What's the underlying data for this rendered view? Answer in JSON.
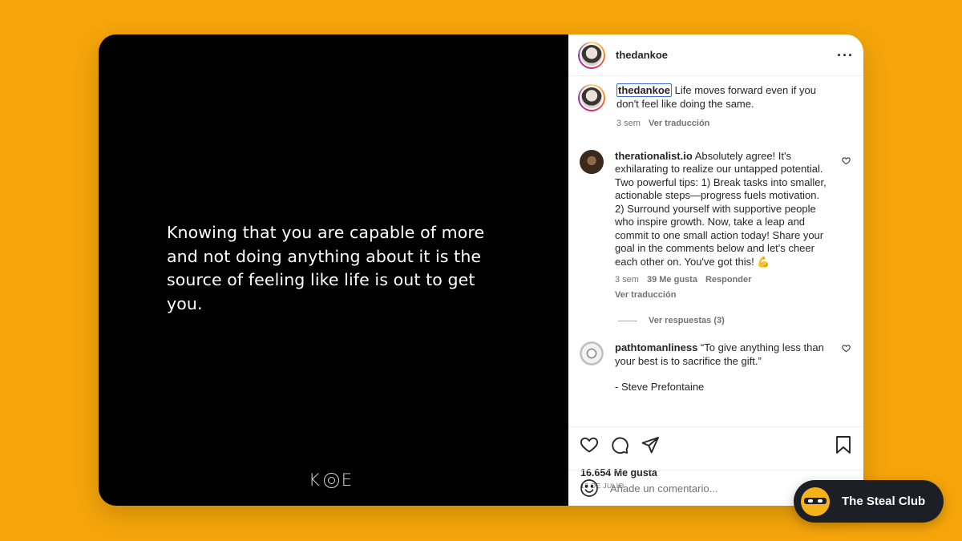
{
  "post": {
    "quote": "Knowing that you are capable of more and not doing anything about it is the source of feeling like life is out to get you.",
    "logo_text": "KOE"
  },
  "header": {
    "username": "thedankoe",
    "more_icon": "more-horizontal-icon"
  },
  "caption": {
    "username": "thedankoe",
    "text": "Life moves forward even if you don't feel like doing the same.",
    "time": "3 sem",
    "translate_label": "Ver traducción"
  },
  "comments": [
    {
      "username": "therationalist.io",
      "text": "Absolutely agree! It's exhilarating to realize our untapped potential. Two powerful tips: 1) Break tasks into smaller, actionable steps—progress fuels motivation. 2) Surround yourself with supportive people who inspire growth. Now, take a leap and commit to one small action today! Share your goal in the comments below and let's cheer each other on. You've got this! 💪",
      "time": "3 sem",
      "likes": "39 Me gusta",
      "reply_label": "Responder",
      "translate_label": "Ver traducción",
      "view_replies": "Ver respuestas (3)"
    },
    {
      "username": "pathtomanliness",
      "text": "“To give anything less than your best is to sacrifice the gift.”",
      "extra": "- Steve Prefontaine"
    }
  ],
  "actions": {
    "likes_count": "16.654 Me gusta",
    "date": "18 DE JULIO"
  },
  "add_comment": {
    "placeholder": "Añade un comentario..."
  },
  "badge": {
    "label": "The Steal Club"
  }
}
